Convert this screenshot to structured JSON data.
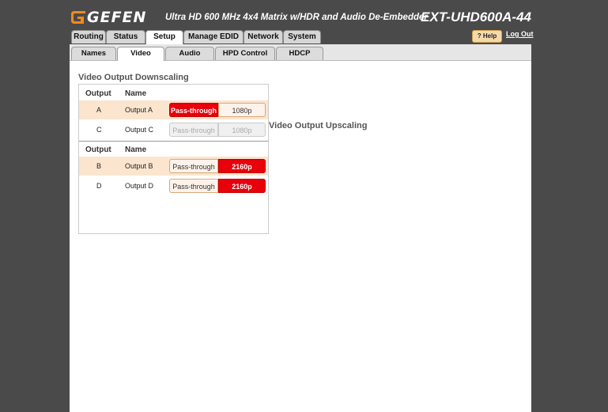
{
  "header": {
    "brand": "GEFEN",
    "subtitle": "Ultra HD 600 MHz 4x4 Matrix w/HDR and Audio De-Embedder",
    "model": "EXT-UHD600A-44",
    "help_label": "? Help",
    "logout_label": "Log Out"
  },
  "main_tabs": [
    {
      "label": "Routing",
      "active": false
    },
    {
      "label": "Status",
      "active": false
    },
    {
      "label": "Setup",
      "active": true
    },
    {
      "label": "Manage EDID",
      "active": false
    },
    {
      "label": "Network",
      "active": false
    },
    {
      "label": "System",
      "active": false
    }
  ],
  "sub_tabs": [
    {
      "label": "Names",
      "active": false
    },
    {
      "label": "Video",
      "active": true
    },
    {
      "label": "Audio",
      "active": false
    },
    {
      "label": "HPD Control",
      "active": false
    },
    {
      "label": "HDCP",
      "active": false
    }
  ],
  "downscaling": {
    "title": "Video Output Downscaling",
    "col_output": "Output",
    "col_name": "Name",
    "rows": [
      {
        "output": "A",
        "name": "Output A",
        "opt1": "Pass-through",
        "opt2": "1080p",
        "selected": "opt1",
        "enabled": true
      },
      {
        "output": "C",
        "name": "Output C",
        "opt1": "Pass-through",
        "opt2": "1080p",
        "selected": "none",
        "enabled": false
      }
    ]
  },
  "upscaling": {
    "title": "Video Output Upscaling",
    "col_output": "Output",
    "col_name": "Name",
    "rows": [
      {
        "output": "B",
        "name": "Output B",
        "opt1": "Pass-through",
        "opt2": "2160p",
        "selected": "opt2",
        "enabled": true
      },
      {
        "output": "D",
        "name": "Output D",
        "opt1": "Pass-through",
        "opt2": "2160p",
        "selected": "opt2",
        "enabled": true
      }
    ]
  },
  "colors": {
    "accent_red": "#e8000b",
    "highlight_row": "#fbe5cf",
    "background": "#4a4a4a"
  }
}
